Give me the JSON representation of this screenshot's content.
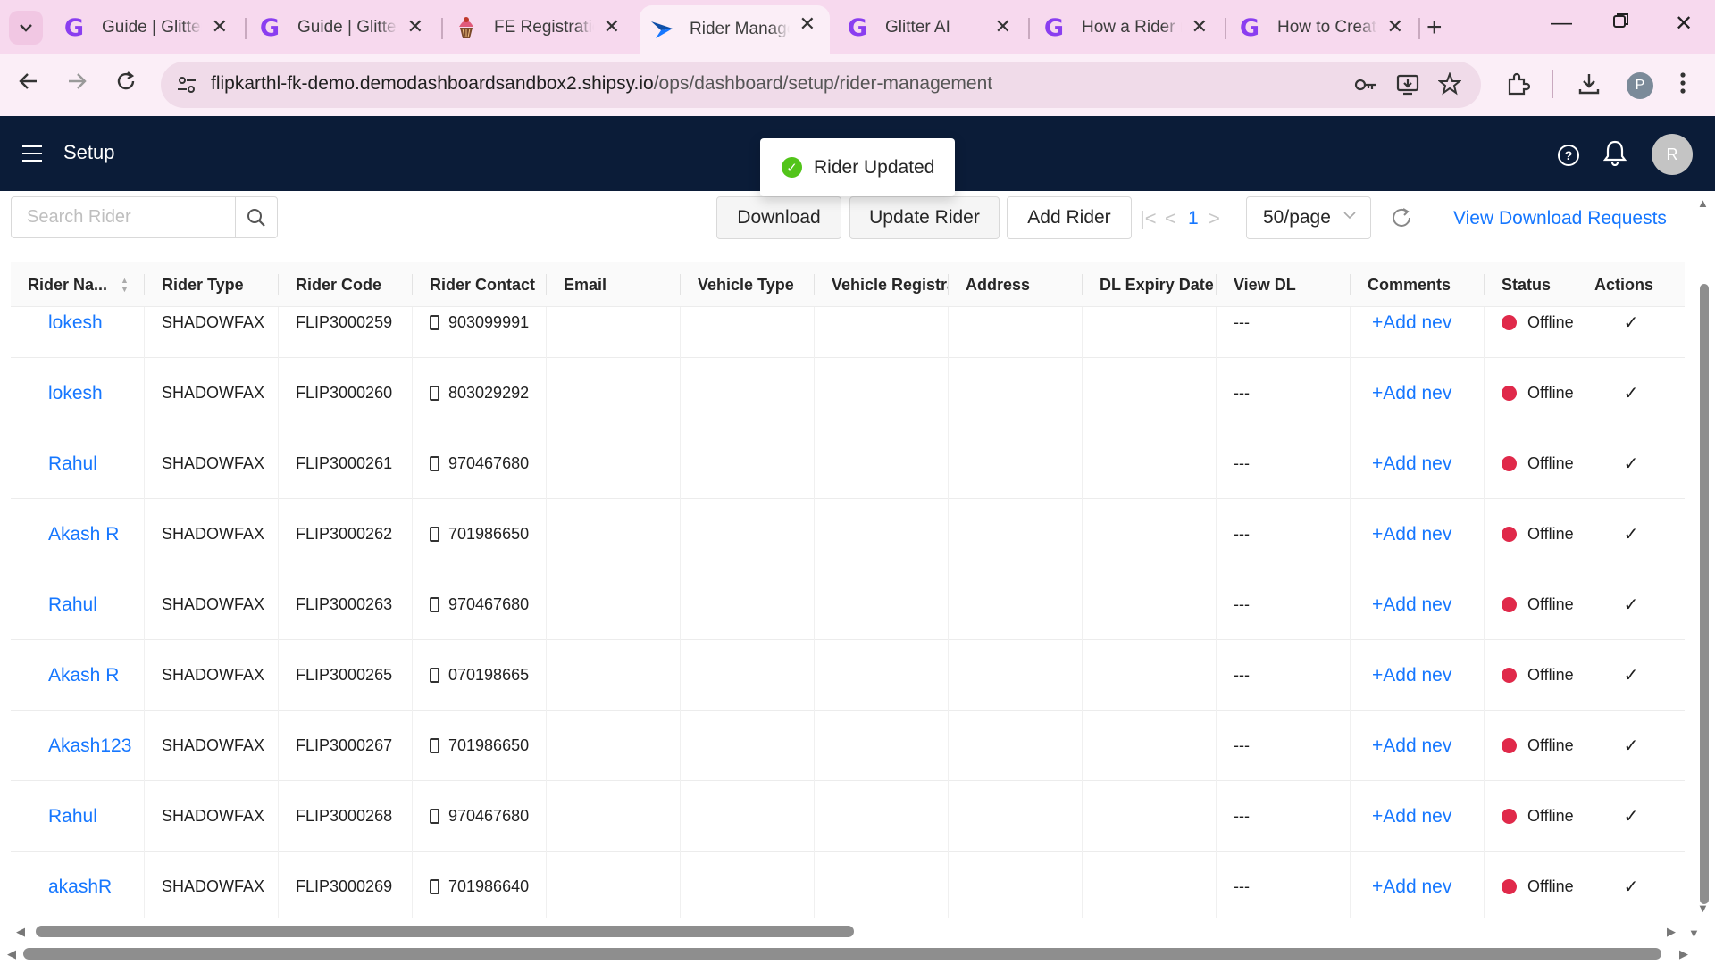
{
  "browser": {
    "tabs": [
      {
        "title": "Guide | Glitter",
        "icon": "glitter-icon",
        "active": false
      },
      {
        "title": "Guide | Glitter",
        "icon": "glitter-icon",
        "active": false
      },
      {
        "title": "FE Registration",
        "icon": "cupcake-icon",
        "active": false
      },
      {
        "title": "Rider Management",
        "icon": "shipsy-icon",
        "active": true
      },
      {
        "title": "Glitter AI",
        "icon": "glitter-icon",
        "active": false
      },
      {
        "title": "How a Rider r",
        "icon": "glitter-icon",
        "active": false
      },
      {
        "title": "How to Create",
        "icon": "glitter-icon",
        "active": false
      }
    ],
    "url_host": "flipkarthl-fk-demo.demodashboardsandbox2.shipsy.io",
    "url_path": "/ops/dashboard/setup/rider-management",
    "profile_initial": "P"
  },
  "app": {
    "title": "Setup",
    "avatar_initial": "R",
    "toast": "Rider Updated"
  },
  "toolbar": {
    "search_placeholder": "Search Rider",
    "download": "Download",
    "update_rider": "Update Rider",
    "add_rider": "Add Rider",
    "page": "1",
    "page_size": "50/page",
    "view_download_requests": "View Download Requests"
  },
  "table": {
    "columns": [
      "Rider Na...",
      "Rider Type",
      "Rider Code",
      "Rider Contact",
      "Email",
      "Vehicle Type",
      "Vehicle Registrat",
      "Address",
      "DL Expiry Date",
      "View DL",
      "Comments",
      "Status",
      "Actions"
    ],
    "rows": [
      {
        "name": "lokesh",
        "type": "SHADOWFAX",
        "code": "FLIP3000259",
        "contact": "903099991",
        "view_dl": "---",
        "comments": "+Add nev",
        "status": "Offline"
      },
      {
        "name": "lokesh",
        "type": "SHADOWFAX",
        "code": "FLIP3000260",
        "contact": "803029292",
        "view_dl": "---",
        "comments": "+Add nev",
        "status": "Offline"
      },
      {
        "name": "Rahul",
        "type": "SHADOWFAX",
        "code": "FLIP3000261",
        "contact": "970467680",
        "view_dl": "---",
        "comments": "+Add nev",
        "status": "Offline"
      },
      {
        "name": "Akash R",
        "type": "SHADOWFAX",
        "code": "FLIP3000262",
        "contact": "701986650",
        "view_dl": "---",
        "comments": "+Add nev",
        "status": "Offline"
      },
      {
        "name": "Rahul",
        "type": "SHADOWFAX",
        "code": "FLIP3000263",
        "contact": "970467680",
        "view_dl": "---",
        "comments": "+Add nev",
        "status": "Offline"
      },
      {
        "name": "Akash R",
        "type": "SHADOWFAX",
        "code": "FLIP3000265",
        "contact": "070198665",
        "view_dl": "---",
        "comments": "+Add nev",
        "status": "Offline"
      },
      {
        "name": "Akash123",
        "type": "SHADOWFAX",
        "code": "FLIP3000267",
        "contact": "701986650",
        "view_dl": "---",
        "comments": "+Add nev",
        "status": "Offline"
      },
      {
        "name": "Rahul",
        "type": "SHADOWFAX",
        "code": "FLIP3000268",
        "contact": "970467680",
        "view_dl": "---",
        "comments": "+Add nev",
        "status": "Offline"
      },
      {
        "name": "akashR",
        "type": "SHADOWFAX",
        "code": "FLIP3000269",
        "contact": "701986640",
        "view_dl": "---",
        "comments": "+Add nev",
        "status": "Offline"
      }
    ]
  },
  "colors": {
    "brand_header": "#0b1c38",
    "link": "#1677ff",
    "status_offline": "#e0294a",
    "success": "#52c41a",
    "tabbar": "#f7d9ee"
  }
}
